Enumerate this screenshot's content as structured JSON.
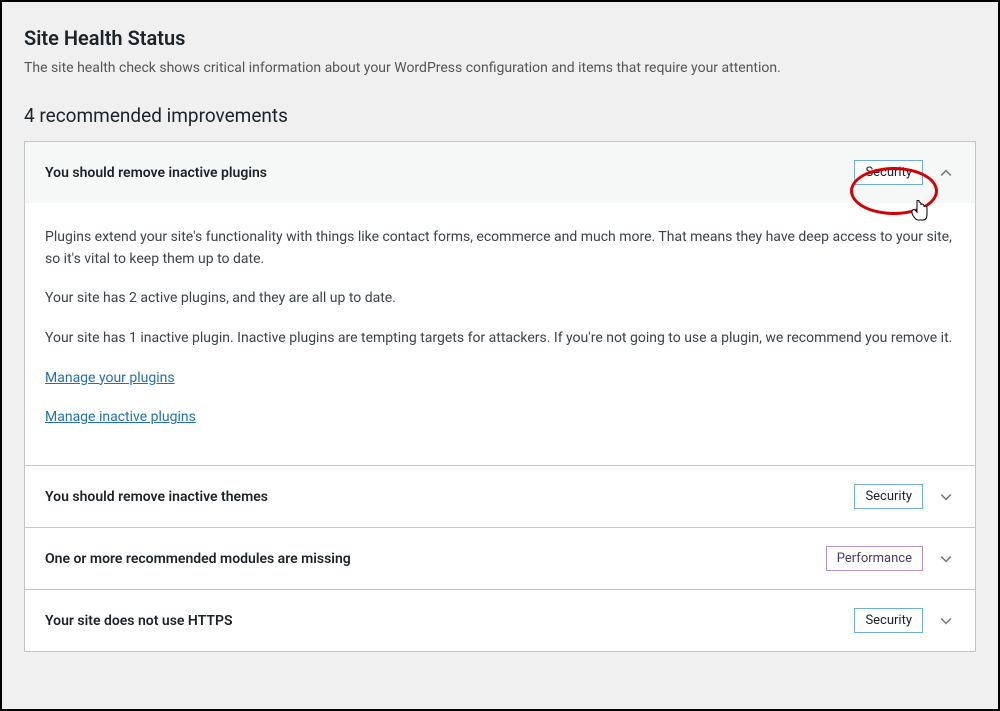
{
  "header": {
    "title": "Site Health Status",
    "description": "The site health check shows critical information about your WordPress configuration and items that require your attention."
  },
  "section": {
    "heading": "4 recommended improvements"
  },
  "items": [
    {
      "title": "You should remove inactive plugins",
      "badge": "Security",
      "badge_class": "blue",
      "expanded": true,
      "para1": "Plugins extend your site's functionality with things like contact forms, ecommerce and much more. That means they have deep access to your site, so it's vital to keep them up to date.",
      "para2": "Your site has 2 active plugins, and they are all up to date.",
      "para3": "Your site has 1 inactive plugin. Inactive plugins are tempting targets for attackers. If you're not going to use a plugin, we recommend you remove it.",
      "link1": "Manage your plugins",
      "link2": "Manage inactive plugins"
    },
    {
      "title": "You should remove inactive themes",
      "badge": "Security",
      "badge_class": "blue",
      "expanded": false
    },
    {
      "title": "One or more recommended modules are missing",
      "badge": "Performance",
      "badge_class": "purple",
      "expanded": false
    },
    {
      "title": "Your site does not use HTTPS",
      "badge": "Security",
      "badge_class": "blue",
      "expanded": false
    }
  ]
}
